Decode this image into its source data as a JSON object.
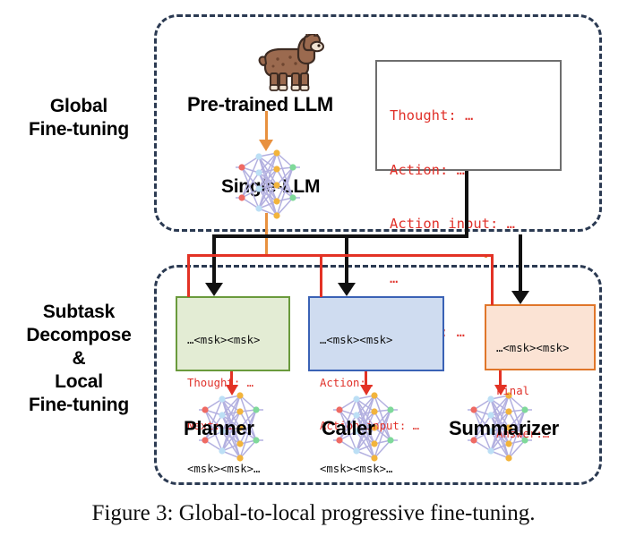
{
  "figure": {
    "caption": "Figure 3: Global-to-local progressive fine-tuning."
  },
  "stages": [
    {
      "id": "global",
      "label": "Global\nFine-tuning"
    },
    {
      "id": "local",
      "label": "Subtask\nDecompose\n&\nLocal\nFine-tuning"
    }
  ],
  "global_stage": {
    "pretrained_label": "Pre-trained  LLM",
    "model_label": "Single-LLM",
    "llama_icon": "llama-icon",
    "network_icon": "neural-network-icon",
    "prompt_box": {
      "name": "global-prompt-box",
      "border_color": "#6e6e6e",
      "background": "#ffffff",
      "lines": [
        {
          "text": "Thought: …",
          "color": "red"
        },
        {
          "text": "Action: …",
          "color": "red"
        },
        {
          "text": "Action input: …",
          "color": "red"
        },
        {
          "text": "…",
          "color": "red"
        },
        {
          "text": "Answer: …",
          "color": "red"
        }
      ]
    }
  },
  "local_stage": {
    "agents": [
      {
        "id": "planner",
        "label": "Planner",
        "accent": "#6a9a3c",
        "background": "#e3ecd4",
        "network_icon": "neural-network-icon",
        "lines": [
          {
            "text": "…<msk><msk>",
            "color": "black"
          },
          {
            "text": "Thought: …",
            "color": "red"
          },
          {
            "text": "Next: …",
            "color": "red"
          },
          {
            "text": "<msk><msk>…",
            "color": "black"
          }
        ]
      },
      {
        "id": "caller",
        "label": "Caller",
        "accent": "#3a62b5",
        "background": "#cfdcf0",
        "network_icon": "neural-network-icon",
        "lines": [
          {
            "text": "…<msk><msk>",
            "color": "black"
          },
          {
            "text": "Action:…",
            "color": "red"
          },
          {
            "text": "Action input: …",
            "color": "red"
          },
          {
            "text": "<msk><msk>…",
            "color": "black"
          }
        ]
      },
      {
        "id": "summarizer",
        "label": "Summarizer",
        "accent": "#e0762a",
        "background": "#fbe3d4",
        "network_icon": "neural-network-icon",
        "lines": [
          {
            "text": "…<msk><msk>",
            "color": "black"
          },
          {
            "text": "Final",
            "color": "red"
          },
          {
            "text": "Answer:…",
            "color": "red"
          }
        ]
      }
    ]
  },
  "colors": {
    "region_border": "#2b3a52",
    "data_flow_black": "#111111",
    "mask_flow_red": "#e33225",
    "weight_flow_orange": "#e8913f",
    "code_red": "#e0312a",
    "code_black": "#111111"
  }
}
